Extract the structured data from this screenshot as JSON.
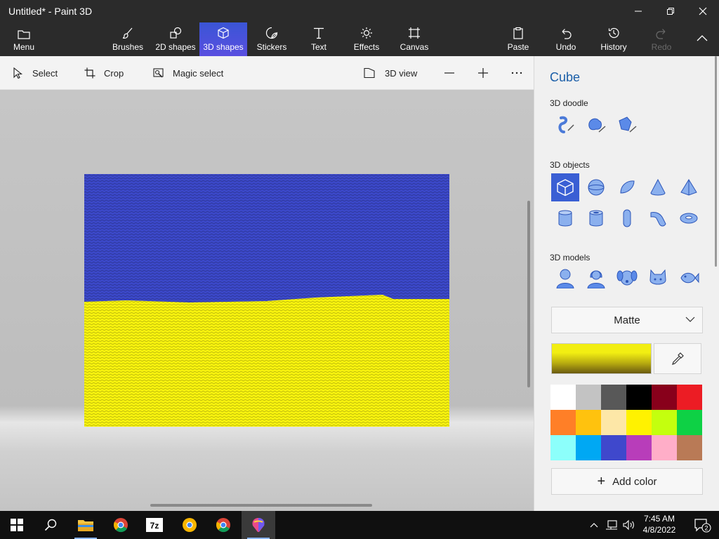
{
  "window": {
    "title": "Untitled* - Paint 3D"
  },
  "ribbon": {
    "menu_label": "Menu",
    "tabs": [
      {
        "label": "Brushes",
        "icon": "brush-icon"
      },
      {
        "label": "2D shapes",
        "icon": "2d-shapes-icon"
      },
      {
        "label": "3D shapes",
        "icon": "cube-icon",
        "active": true
      },
      {
        "label": "Stickers",
        "icon": "sticker-icon"
      },
      {
        "label": "Text",
        "icon": "text-icon"
      },
      {
        "label": "Effects",
        "icon": "effects-icon"
      },
      {
        "label": "Canvas",
        "icon": "canvas-icon"
      }
    ],
    "actions": [
      {
        "label": "Paste",
        "icon": "paste-icon"
      },
      {
        "label": "Undo",
        "icon": "undo-icon"
      },
      {
        "label": "History",
        "icon": "history-icon"
      },
      {
        "label": "Redo",
        "icon": "redo-icon",
        "disabled": true
      }
    ]
  },
  "toolbar": {
    "select_label": "Select",
    "crop_label": "Crop",
    "magic_select_label": "Magic select",
    "view3d_label": "3D view"
  },
  "panel": {
    "title": "Cube",
    "doodle_label": "3D doodle",
    "objects_label": "3D objects",
    "models_label": "3D models",
    "objects": [
      "cube-icon",
      "sphere-icon",
      "hemisphere-icon",
      "cone-icon",
      "pyramid-icon",
      "cylinder-icon",
      "tube-icon",
      "capsule-icon",
      "curved-tube-icon",
      "donut-icon"
    ],
    "models": [
      "man-icon",
      "woman-icon",
      "dog-icon",
      "cat-icon",
      "fish-icon"
    ],
    "material": "Matte",
    "current_color": "#f2ee12",
    "palette": [
      "#ffffff",
      "#c3c3c3",
      "#585858",
      "#000000",
      "#88001b",
      "#ec1c24",
      "#ff7f27",
      "#ffc20e",
      "#fde7a7",
      "#fff200",
      "#c4ff0e",
      "#0ed145",
      "#8cfffb",
      "#00a8f3",
      "#3f48cc",
      "#b83dba",
      "#ffaec8",
      "#b97a56"
    ],
    "add_color_label": "Add color"
  },
  "canvas": {
    "flag_top": "#3b48c8",
    "flag_bottom": "#f7f20e"
  },
  "taskbar": {
    "apps": [
      "start-icon",
      "search-icon",
      "file-explorer-icon",
      "chrome-icon",
      "7zip-icon",
      "chrome-icon",
      "chrome-icon",
      "paint3d-icon"
    ],
    "time": "7:45 AM",
    "date": "4/8/2022",
    "notification_count": "2"
  }
}
